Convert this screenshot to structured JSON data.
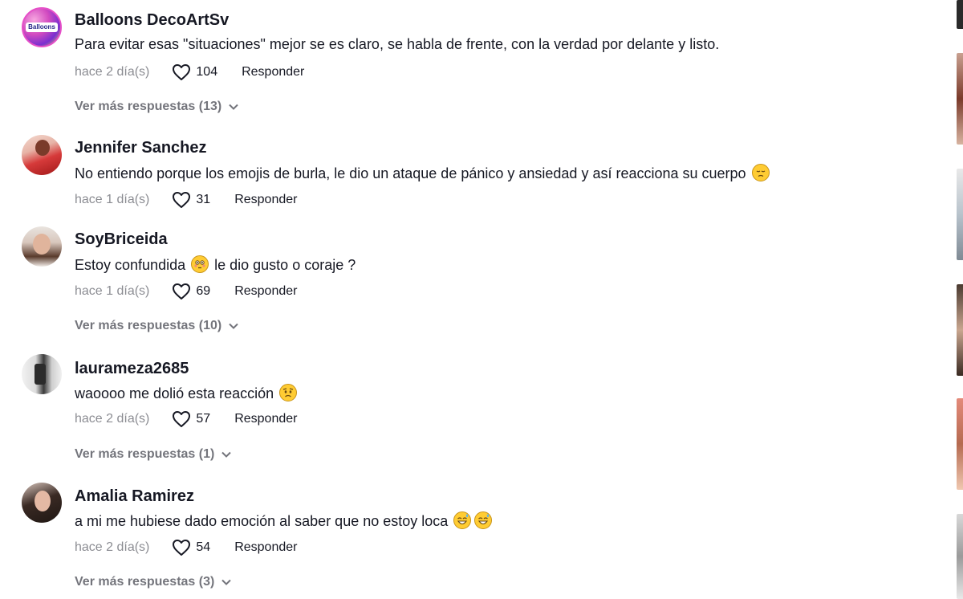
{
  "comments": [
    {
      "username": "Balloons DecoArtSv",
      "text": "Para evitar esas \"situaciones\" mejor se es claro, se habla de frente, con la verdad por delante y listo.",
      "date": "hace 2 día(s)",
      "likes": "104",
      "reply_label": "Responder",
      "more_replies": "Ver más respuestas (13)",
      "avatar_logo_text": "Balloons"
    },
    {
      "username": "Jennifer Sanchez",
      "text": "No entiendo porque los emojis de burla, le dio un ataque de pánico y ansiedad y así reacciona su cuerpo",
      "emojis": [
        "pensive-face"
      ],
      "date": "hace 1 día(s)",
      "likes": "31",
      "reply_label": "Responder"
    },
    {
      "username": "SoyBriceida",
      "text_before": "Estoy confundida",
      "text_after": "le dio gusto o coraje ?",
      "emojis": [
        "flushed-face"
      ],
      "date": "hace 1 día(s)",
      "likes": "69",
      "reply_label": "Responder",
      "more_replies": "Ver más respuestas (10)"
    },
    {
      "username": "laurameza2685",
      "text": "waoooo me dolió esta reacción",
      "emojis": [
        "worried-face"
      ],
      "date": "hace 2 día(s)",
      "likes": "57",
      "reply_label": "Responder",
      "more_replies": "Ver más respuestas (1)"
    },
    {
      "username": "Amalia Ramirez",
      "text": "a mi me hubiese dado emoción al saber que no estoy loca",
      "emojis": [
        "grinning-sweat-face",
        "grinning-sweat-face"
      ],
      "date": "hace 2 día(s)",
      "likes": "54",
      "reply_label": "Responder",
      "more_replies": "Ver más respuestas (3)"
    }
  ],
  "icons": {
    "like": "heart-outline-icon",
    "expand": "chevron-down-icon"
  },
  "colors": {
    "text": "#161823",
    "muted": "#8a8b91",
    "emoji": "#ffcc33"
  }
}
